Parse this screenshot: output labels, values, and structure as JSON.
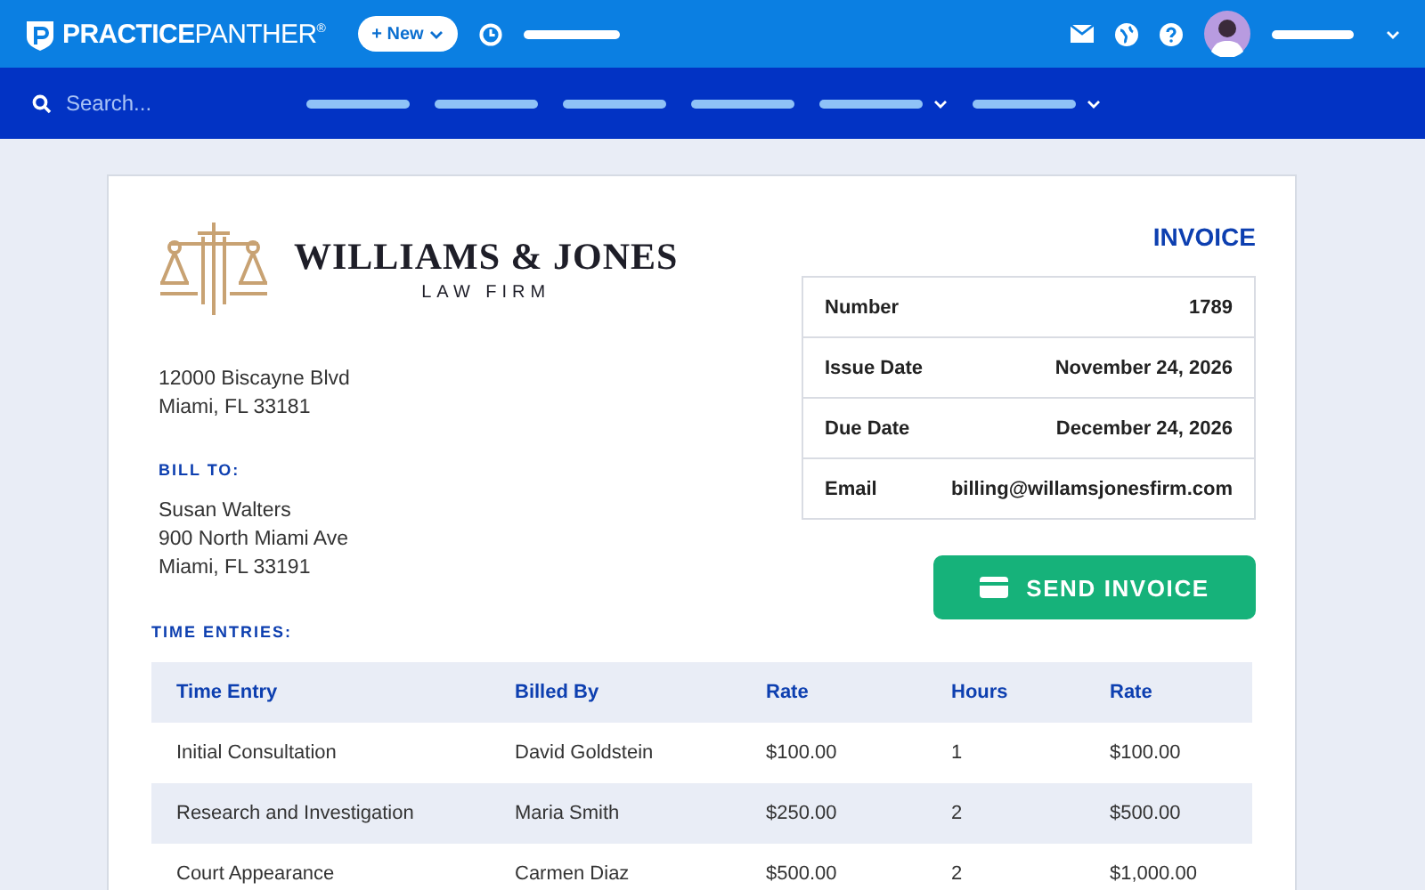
{
  "top_bar": {
    "logo": "**PRACTICE**PANTHER$^{®}$",
    "new_button": "+ New",
    "nav_items": [
      {
        "has_menu": false
      },
      {
        "has_menu": false
      },
      {
        "has_menu": false
      },
      {
        "has_menu": false
      },
      {
        "has_menu": true
      },
      {
        "has_menu": true
      }
    ]
  },
  "search": {
    "placeholder": "Search..."
  },
  "invoice": {
    "firm_name": "WILLIAMS & JONES",
    "firm_subtitle": "LAW FIRM",
    "address": [
      "12000 Biscayne Blvd",
      "Miami, FL 33181"
    ],
    "bill_to_label": "BILL TO:",
    "bill_to": [
      "Susan Walters",
      "900 North Miami Ave",
      "Miami, FL 33191"
    ],
    "title": "INVOICE",
    "details": [
      {
        "label": "Number",
        "value": "1789"
      },
      {
        "label": "Issue Date",
        "value": "November 24, 2026"
      },
      {
        "label": "Due Date",
        "value": "December 24, 2026"
      },
      {
        "label": "Email",
        "value": "billing@willamsjonesfirm.com"
      }
    ],
    "send_button": "SEND INVOICE",
    "entries_label": "TIME ENTRIES:",
    "table": {
      "columns": [
        "Time Entry",
        "Billed By",
        "Rate",
        "Hours",
        "Rate"
      ],
      "rows": [
        [
          "Initial Consultation",
          "David Goldstein",
          "$100.00",
          "1",
          "$100.00"
        ],
        [
          "Research and Investigation",
          "Maria Smith",
          "$250.00",
          "2",
          "$500.00"
        ],
        [
          "Court Appearance",
          "Carmen Diaz",
          "$500.00",
          "2",
          "$1,000.00"
        ]
      ]
    }
  }
}
